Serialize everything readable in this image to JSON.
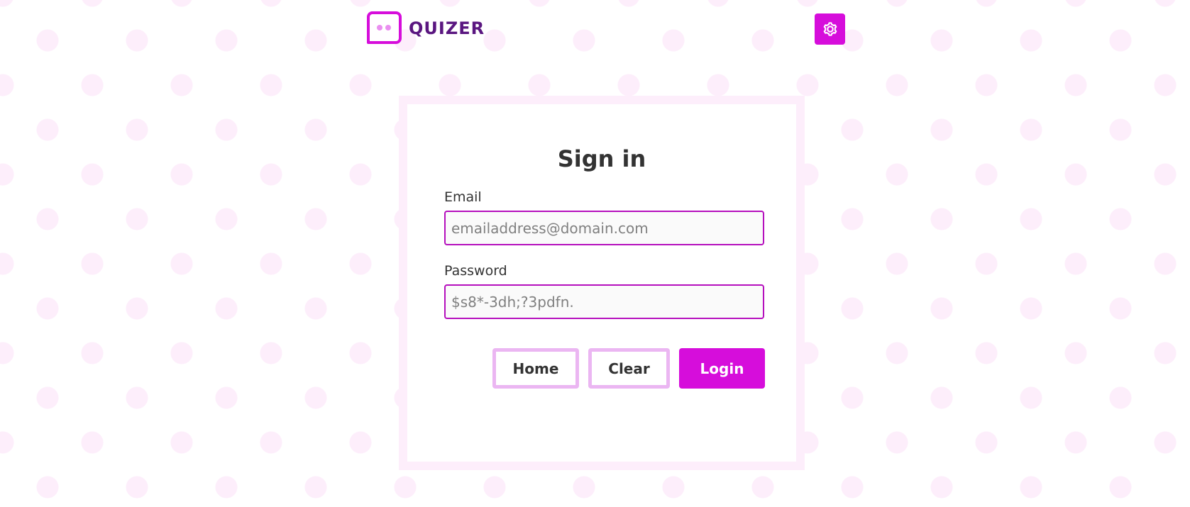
{
  "header": {
    "app_name": "QUIZER",
    "logo_icon": "chat-bubble-icon",
    "settings_icon": "gear-icon"
  },
  "signin": {
    "title": "Sign in",
    "email": {
      "label": "Email",
      "placeholder": "emailaddress@domain.com",
      "value": ""
    },
    "password": {
      "label": "Password",
      "placeholder": "$s8*-3dh;?3pdfn.",
      "value": ""
    },
    "buttons": {
      "home": "Home",
      "clear": "Clear",
      "login": "Login"
    }
  },
  "colors": {
    "accent": "#d60ddb",
    "brand_text": "#5a1680",
    "field_border": "#b50fbd",
    "outline_button_border": "#ebb6f2",
    "background_dots": "#fdeefb"
  }
}
